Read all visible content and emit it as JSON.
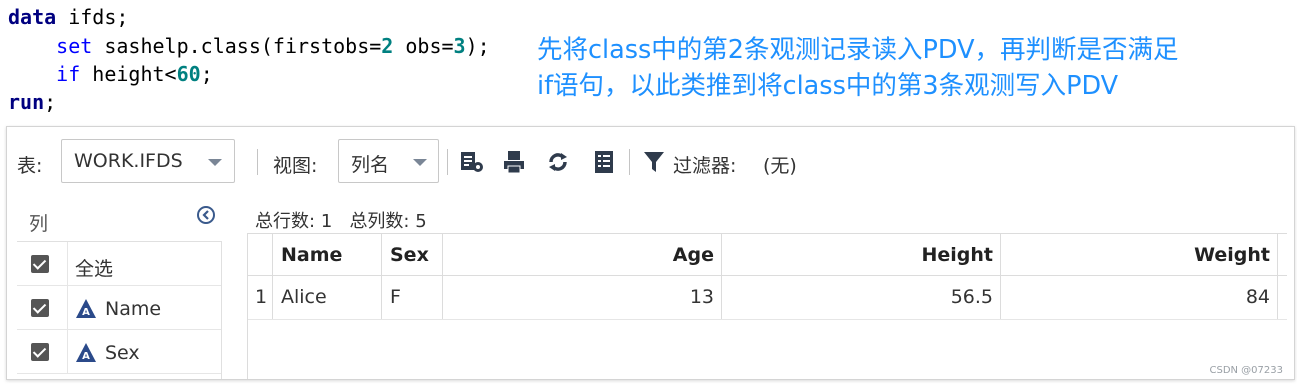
{
  "code": {
    "line1": {
      "kw": "data",
      "rest": " ifds;"
    },
    "line2": {
      "indent": "    ",
      "kw": "set",
      "mid": " sashelp.class(firstobs=",
      "n1": "2",
      "mid2": " obs=",
      "n2": "3",
      "end": ");"
    },
    "line3": {
      "indent": "    ",
      "kw": "if",
      "mid": " height<",
      "n1": "60",
      "end": ";"
    },
    "line4": {
      "kw": "run",
      "end": ";"
    }
  },
  "annotation": {
    "line1": "先将class中的第2条观测记录读入PDV，再判断是否满足",
    "line2": "if语句，以此类推到将class中的第3条观测写入PDV"
  },
  "toolbar": {
    "table_label": "表:",
    "table_value": "WORK.IFDS",
    "view_label": "视图:",
    "view_value": "列名",
    "filter_label": "过滤器:",
    "filter_value": "(无)",
    "icons": [
      "properties-icon",
      "print-icon",
      "refresh-icon",
      "columns-icon",
      "filter-icon"
    ]
  },
  "columns_panel": {
    "title": "列",
    "select_all": "全选",
    "items": [
      {
        "label": "Name",
        "icon": "character-column-icon"
      },
      {
        "label": "Sex",
        "icon": "character-column-icon"
      }
    ]
  },
  "summary": {
    "rows_label": "总行数:",
    "rows": "1",
    "cols_label": "总列数:",
    "cols": "5"
  },
  "grid": {
    "headers": [
      "Name",
      "Sex",
      "Age",
      "Height",
      "Weight"
    ],
    "rows": [
      {
        "index": "1",
        "cells": [
          "Alice",
          "F",
          "13",
          "56.5",
          "84"
        ]
      }
    ]
  },
  "watermark": "CSDN @07233",
  "colors": {
    "annotation": "#1e90ff",
    "keyword_bold": "#000080",
    "keyword": "#0000ff",
    "number": "#008080"
  }
}
